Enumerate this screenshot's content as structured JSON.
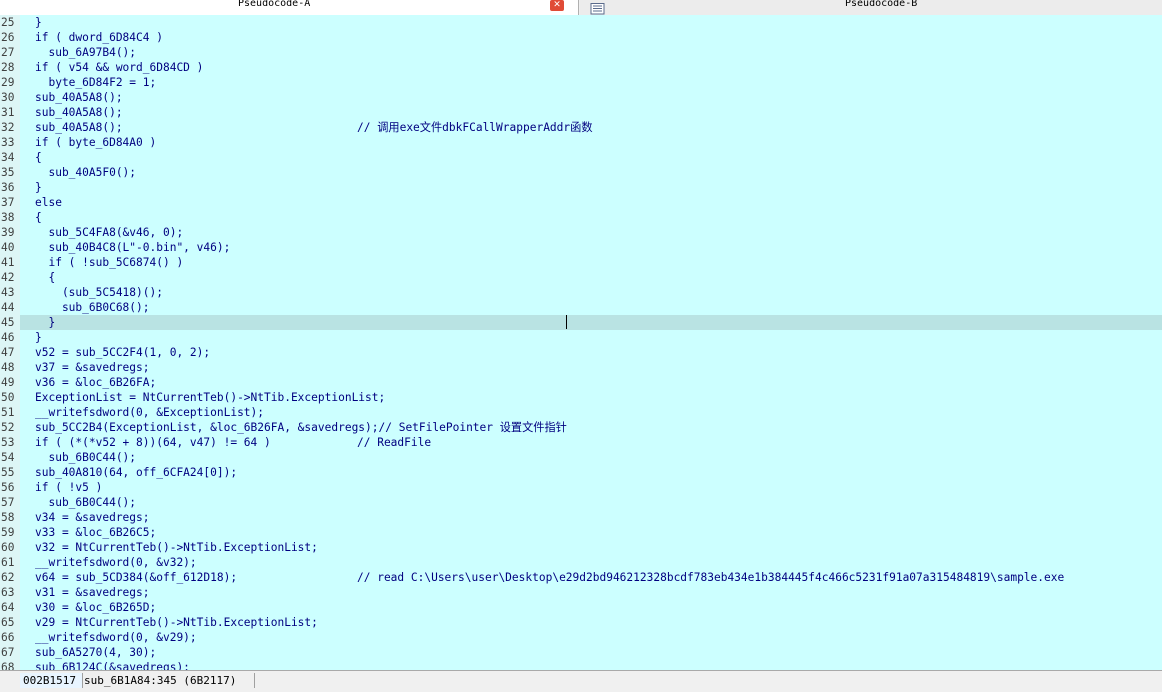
{
  "tabs": [
    {
      "label": "Pseudocode-A"
    },
    {
      "label": "Pseudocode-B"
    }
  ],
  "tab_icons": {
    "close": "close-icon",
    "doc": "document-icon"
  },
  "colors": {
    "background": "#ccffff",
    "highlight_line": "#b9e3e3",
    "code": "#000080",
    "variable": "#6f7fb8",
    "string": "#008000",
    "close_button": "#e04b36"
  },
  "lines": [
    {
      "n": "25",
      "text": "}"
    },
    {
      "n": "26",
      "text": "if ( dword_6D84C4 )"
    },
    {
      "n": "27",
      "text": "  sub_6A97B4();"
    },
    {
      "n": "28",
      "text": "if ( v54 && word_6D84CD )"
    },
    {
      "n": "29",
      "text": "  byte_6D84F2 = 1;"
    },
    {
      "n": "30",
      "text": "sub_40A5A8();"
    },
    {
      "n": "31",
      "text": "sub_40A5A8();"
    },
    {
      "n": "32",
      "text": "sub_40A5A8();",
      "comment": "// 调用exe文件dbkFCallWrapperAddr函数"
    },
    {
      "n": "33",
      "text": "if ( byte_6D84A0 )"
    },
    {
      "n": "34",
      "text": "{"
    },
    {
      "n": "35",
      "text": "  sub_40A5F0();"
    },
    {
      "n": "36",
      "text": "}"
    },
    {
      "n": "37",
      "text": "else"
    },
    {
      "n": "38",
      "text": "{"
    },
    {
      "n": "39",
      "text": "  sub_5C4FA8(&v46, 0);"
    },
    {
      "n": "40",
      "text": "  sub_40B4C8(L\"-0.bin\", v46);"
    },
    {
      "n": "41",
      "text": "  if ( !sub_5C6874() )"
    },
    {
      "n": "42",
      "text": "  {"
    },
    {
      "n": "43",
      "text": "    (sub_5C5418)();"
    },
    {
      "n": "44",
      "text": "    sub_6B0C68();"
    },
    {
      "n": "45",
      "text": "  }",
      "highlight": true
    },
    {
      "n": "46",
      "text": "}"
    },
    {
      "n": "47",
      "text": "v52 = sub_5CC2F4(1, 0, 2);"
    },
    {
      "n": "48",
      "text": "v37 = &savedregs;"
    },
    {
      "n": "49",
      "text": "v36 = &loc_6B26FA;"
    },
    {
      "n": "50",
      "text": "ExceptionList = NtCurrentTeb()->NtTib.ExceptionList;"
    },
    {
      "n": "51",
      "text": "__writefsdword(0, &ExceptionList);"
    },
    {
      "n": "52",
      "text": "sub_5CC2B4(ExceptionList, &loc_6B26FA, &savedregs);// SetFilePointer 设置文件指针"
    },
    {
      "n": "53",
      "text": "if ( (*(*v52 + 8))(64, v47) != 64 )",
      "comment": "// ReadFile"
    },
    {
      "n": "54",
      "text": "  sub_6B0C44();"
    },
    {
      "n": "55",
      "text": "sub_40A810(64, off_6CFA24[0]);"
    },
    {
      "n": "56",
      "text": "if ( !v5 )"
    },
    {
      "n": "57",
      "text": "  sub_6B0C44();"
    },
    {
      "n": "58",
      "text": "v34 = &savedregs;"
    },
    {
      "n": "59",
      "text": "v33 = &loc_6B26C5;"
    },
    {
      "n": "60",
      "text": "v32 = NtCurrentTeb()->NtTib.ExceptionList;"
    },
    {
      "n": "61",
      "text": "__writefsdword(0, &v32);"
    },
    {
      "n": "62",
      "text": "v64 = sub_5CD384(&off_612D18);",
      "comment": "// read C:\\Users\\user\\Desktop\\e29d2bd946212328bcdf783eb434e1b384445f4c466c5231f91a07a315484819\\sample.exe"
    },
    {
      "n": "63",
      "text": "v31 = &savedregs;"
    },
    {
      "n": "64",
      "text": "v30 = &loc_6B265D;"
    },
    {
      "n": "65",
      "text": "v29 = NtCurrentTeb()->NtTib.ExceptionList;"
    },
    {
      "n": "66",
      "text": "__writefsdword(0, &v29);"
    },
    {
      "n": "67",
      "text": "sub_6A5270(4, 30);"
    },
    {
      "n": "68",
      "text": "sub_6B124C(&savedregs);"
    }
  ],
  "status": {
    "address": "002B1517",
    "location": "sub_6B1A84:345 (6B2117)"
  }
}
